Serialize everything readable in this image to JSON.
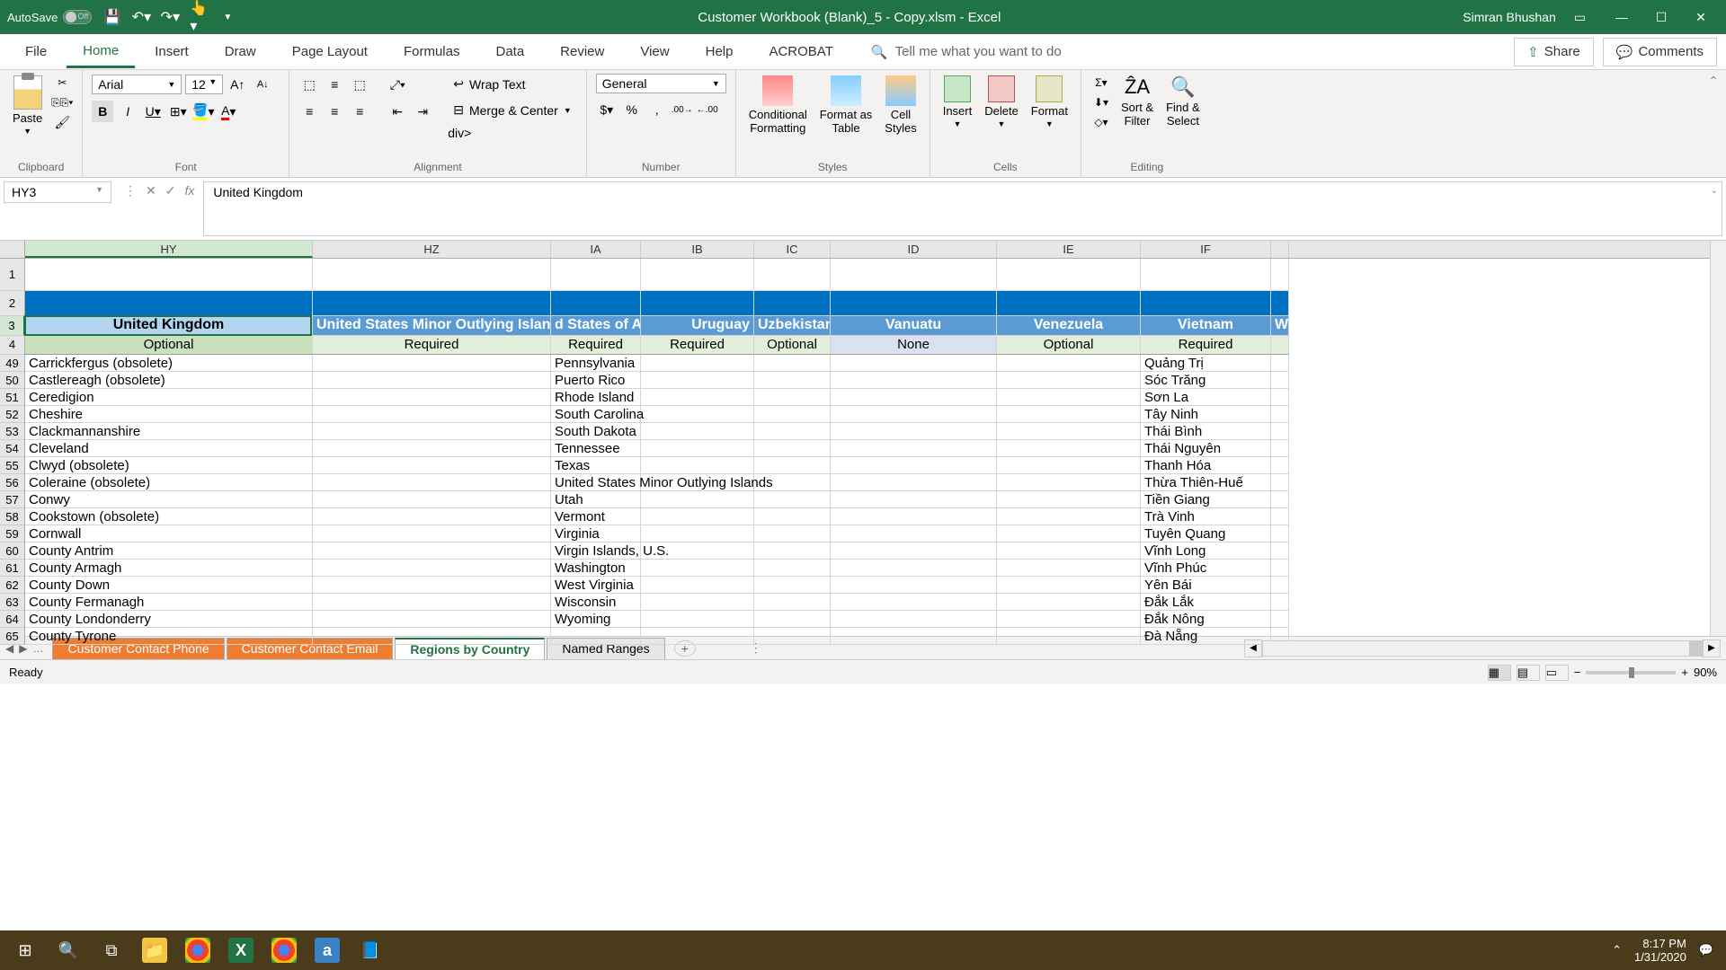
{
  "titlebar": {
    "autosave": "AutoSave",
    "autosave_state": "Off",
    "filename": "Customer Workbook (Blank)_5 - Copy.xlsm  -  Excel",
    "username": "Simran Bhushan"
  },
  "tabs": {
    "file": "File",
    "home": "Home",
    "insert": "Insert",
    "draw": "Draw",
    "page_layout": "Page Layout",
    "formulas": "Formulas",
    "data": "Data",
    "review": "Review",
    "view": "View",
    "help": "Help",
    "acrobat": "ACROBAT",
    "tell_me": "Tell me what you want to do",
    "share": "Share",
    "comments": "Comments"
  },
  "ribbon": {
    "clipboard": {
      "paste": "Paste",
      "label": "Clipboard"
    },
    "font": {
      "name": "Arial",
      "size": "12",
      "label": "Font"
    },
    "alignment": {
      "wrap": "Wrap Text",
      "merge": "Merge & Center",
      "label": "Alignment"
    },
    "number": {
      "format": "General",
      "label": "Number"
    },
    "styles": {
      "cond": "Conditional\nFormatting",
      "table": "Format as\nTable",
      "cell": "Cell\nStyles",
      "label": "Styles"
    },
    "cells": {
      "insert": "Insert",
      "delete": "Delete",
      "format": "Format",
      "label": "Cells"
    },
    "editing": {
      "sort": "Sort &\nFilter",
      "find": "Find &\nSelect",
      "label": "Editing"
    }
  },
  "formula_bar": {
    "cell_ref": "HY3",
    "value": "United Kingdom"
  },
  "columns": [
    "HY",
    "HZ",
    "IA",
    "IB",
    "IC",
    "ID",
    "IE",
    "IF"
  ],
  "frozen_rows": [
    "1",
    "2",
    "3",
    "4"
  ],
  "header_row": {
    "HY": "United Kingdom",
    "HZ": "United States Minor Outlying Islands",
    "IA": "d States of Ar",
    "IB": "Uruguay",
    "IC": "Uzbekistan",
    "ID": "Vanuatu",
    "IE": "Venezuela",
    "IF": "Vietnam",
    "IG": "Wa"
  },
  "req_row": {
    "HY": "Optional",
    "HZ": "Required",
    "IA": "Required",
    "IB": "Required",
    "IC": "Optional",
    "ID": "None",
    "IE": "Optional",
    "IF": "Required"
  },
  "data_rows": [
    {
      "n": "49",
      "HY": "Carrickfergus (obsolete)",
      "IA": "Pennsylvania",
      "IF": "Quảng Trị"
    },
    {
      "n": "50",
      "HY": "Castlereagh (obsolete)",
      "IA": "Puerto Rico",
      "IF": "Sóc Trăng"
    },
    {
      "n": "51",
      "HY": "Ceredigion",
      "IA": "Rhode Island",
      "IF": "Sơn La"
    },
    {
      "n": "52",
      "HY": "Cheshire",
      "IA": "South Carolina",
      "IF": "Tây Ninh"
    },
    {
      "n": "53",
      "HY": "Clackmannanshire",
      "IA": "South Dakota",
      "IF": "Thái Bình"
    },
    {
      "n": "54",
      "HY": "Cleveland",
      "IA": "Tennessee",
      "IF": "Thái Nguyên"
    },
    {
      "n": "55",
      "HY": "Clwyd (obsolete)",
      "IA": "Texas",
      "IF": "Thanh Hóa"
    },
    {
      "n": "56",
      "HY": "Coleraine (obsolete)",
      "IA": "United States Minor Outlying Islands",
      "IF": "Thừa Thiên-Huế"
    },
    {
      "n": "57",
      "HY": "Conwy",
      "IA": "Utah",
      "IF": "Tiền Giang"
    },
    {
      "n": "58",
      "HY": "Cookstown (obsolete)",
      "IA": "Vermont",
      "IF": "Trà Vinh"
    },
    {
      "n": "59",
      "HY": "Cornwall",
      "IA": "Virginia",
      "IF": "Tuyên Quang"
    },
    {
      "n": "60",
      "HY": "County Antrim",
      "IA": "Virgin Islands, U.S.",
      "IF": "Vĩnh Long"
    },
    {
      "n": "61",
      "HY": "County Armagh",
      "IA": "Washington",
      "IF": "Vĩnh Phúc"
    },
    {
      "n": "62",
      "HY": "County Down",
      "IA": "West Virginia",
      "IF": "Yên Bái"
    },
    {
      "n": "63",
      "HY": "County Fermanagh",
      "IA": "Wisconsin",
      "IF": "Đắk Lắk"
    },
    {
      "n": "64",
      "HY": "County Londonderry",
      "IA": "Wyoming",
      "IF": "Đắk Nông"
    },
    {
      "n": "65",
      "HY": "County Tyrone",
      "IA": "",
      "IF": "Đà Nẵng"
    }
  ],
  "sheets": {
    "s1": "Customer Contact Phone",
    "s2": "Customer Contact Email",
    "s3": "Regions by Country",
    "s4": "Named Ranges"
  },
  "status": {
    "ready": "Ready",
    "zoom": "90%"
  },
  "tray": {
    "time": "8:17 PM",
    "date": "1/31/2020"
  }
}
